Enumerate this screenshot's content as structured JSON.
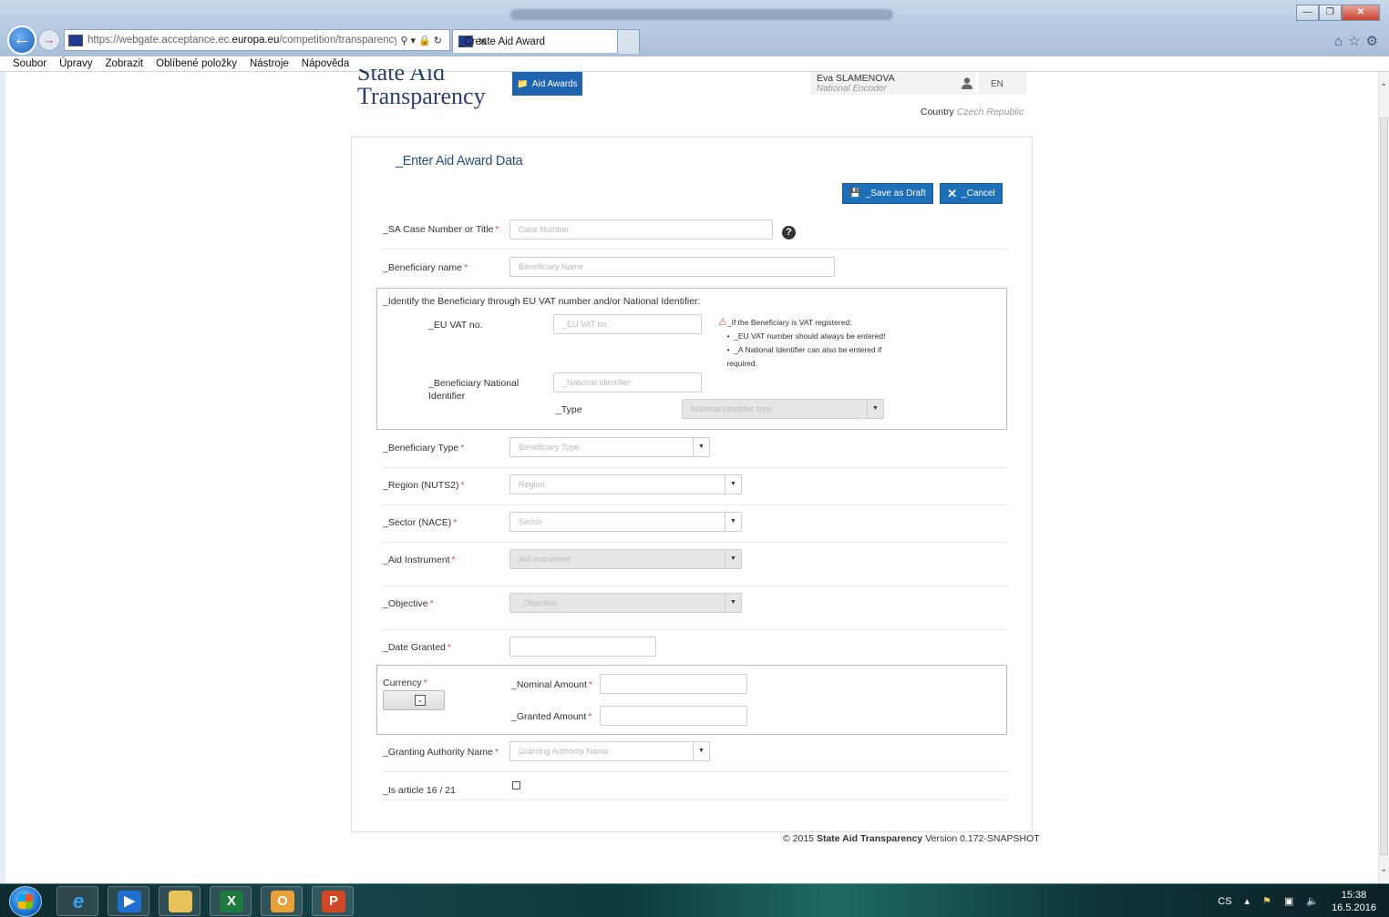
{
  "browser": {
    "url_prefix": "https://webgate.acceptance.ec.",
    "url_domain": "europa.eu",
    "url_rest": "/competition/transparency/i",
    "tab_title": "_Create Aid Award",
    "menu": [
      "Soubor",
      "Úpravy",
      "Zobrazit",
      "Oblíbené položky",
      "Nástroje",
      "Nápověda"
    ]
  },
  "header": {
    "logo_line1": "State Aid",
    "logo_line2": "Transparency",
    "nav_button": "Aid Awards",
    "user_name": "Eva SLAMENOVA",
    "user_role": "National Encoder",
    "language": "EN",
    "country_label": "Country",
    "country_value": "Czech Republic"
  },
  "form": {
    "title": "_Enter Aid Award Data",
    "save_draft": "_Save as Draft",
    "cancel": "_Cancel",
    "case_number": {
      "label": "_SA Case Number or Title",
      "placeholder": "Case Number"
    },
    "beneficiary_name": {
      "label": "_Beneficiary name",
      "placeholder": "Beneficiary Name"
    },
    "identify_heading": "_Identify the Beneficiary through EU VAT number and/or National Identifier:",
    "eu_vat": {
      "label": "_EU VAT no.",
      "placeholder": "_EU VAT no."
    },
    "vat_note_title": "_If the Beneficiary is VAT registered:",
    "vat_note_items": [
      "_EU VAT number should always be entered!",
      "_A National Identifier can also be entered if"
    ],
    "vat_note_tail": "required.",
    "national_id": {
      "label_line1": "_Beneficiary National",
      "label_line2": "Identifier",
      "placeholder": "_National identifier"
    },
    "type": {
      "label": "_Type",
      "placeholder": "National identifier type"
    },
    "beneficiary_type": {
      "label": "_Beneficiary Type",
      "placeholder": "Beneficiary Type"
    },
    "region": {
      "label": "_Region (NUTS2)",
      "placeholder": "Region"
    },
    "sector": {
      "label": "_Sector (NACE)",
      "placeholder": "Sector"
    },
    "aid_instrument": {
      "label": "_Aid Instrument",
      "placeholder": "Aid instrument"
    },
    "objective": {
      "label": "_Objective",
      "placeholder": "_Objective"
    },
    "date_granted": {
      "label": "_Date Granted",
      "value": ""
    },
    "currency": {
      "label": "Currency"
    },
    "nominal_amount": {
      "label": "_Nominal Amount",
      "value": ""
    },
    "granted_amount": {
      "label": "_Granted Amount",
      "value": ""
    },
    "granting_authority": {
      "label": "_Granting Authority Name",
      "placeholder": "Granting Authority Name"
    },
    "article": {
      "label": "_Is article 16 / 21"
    },
    "required_mark": "*"
  },
  "footer": {
    "copyright": "© 2015",
    "product": "State Aid Transparency",
    "version": "Version 0.172-SNAPSHOT"
  },
  "taskbar": {
    "language": "CS",
    "time": "15:38",
    "date": "16.5.2016"
  }
}
